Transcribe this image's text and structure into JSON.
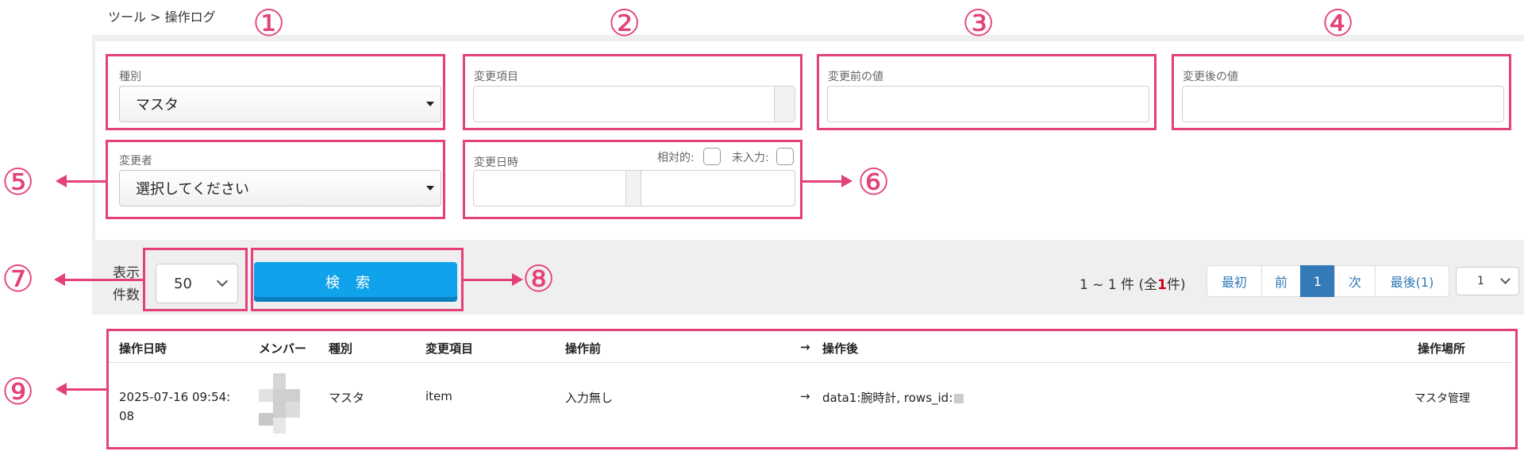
{
  "breadcrumb": "ツール > 操作ログ",
  "markers": [
    "①",
    "②",
    "③",
    "④",
    "⑤",
    "⑥",
    "⑦",
    "⑧",
    "⑨"
  ],
  "fields": {
    "type_label": "種別",
    "type_value": "マスタ",
    "item_label": "変更項目",
    "before_label": "変更前の値",
    "after_label": "変更後の値",
    "changer_label": "変更者",
    "changer_value": "選択してください",
    "datetime_label": "変更日時",
    "relative_label": "相対的:",
    "empty_label": "未入力:"
  },
  "controls": {
    "display_label": "表示件数",
    "display_label_1": "表示",
    "display_label_2": "件数",
    "per_page": "50",
    "search_label": "検索",
    "result_pre": "1 ~ 1 件 (全",
    "result_total": "1",
    "result_post": "件)"
  },
  "pagination": {
    "first": "最初",
    "prev": "前",
    "current": "1",
    "next": "次",
    "last": "最後(1)",
    "page_select": "1"
  },
  "table": {
    "headers": {
      "datetime": "操作日時",
      "member": "メンバー",
      "type": "種別",
      "item": "変更項目",
      "before": "操作前",
      "arrow": "→",
      "after": "操作後",
      "location": "操作場所"
    },
    "rows": [
      {
        "datetime_1": "2025-07-16 09:54:",
        "datetime_2": "08",
        "type": "マスタ",
        "item": "item",
        "before": "入力無し",
        "arrow": "→",
        "after": "data1:腕時計, rows_id:",
        "location": "マスタ管理"
      }
    ]
  },
  "colors": {
    "highlight": "#e4407a",
    "search_button": "#10a3eb",
    "active_page": "#337ab7"
  }
}
